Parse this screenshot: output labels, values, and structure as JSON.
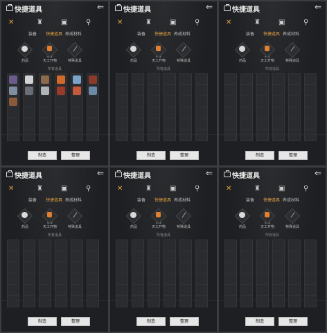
{
  "panels": [
    {
      "title": "快捷道具",
      "tabs": [
        "装备",
        "快捷道具",
        "养成材料"
      ],
      "cats": [
        {
          "name": "药品",
          "count": "4"
        },
        {
          "name": "天工开物",
          "count": "412"
        },
        {
          "name": "特殊道具",
          "count": "1"
        }
      ],
      "section": "所有道具",
      "buttons": [
        "制造",
        "整理"
      ]
    },
    {
      "title": "快捷道具",
      "tabs": [
        "装备",
        "快捷道具",
        "养成材料"
      ],
      "cats": [
        {
          "name": "药品",
          "count": "4"
        },
        {
          "name": "天工开物",
          "count": "412"
        },
        {
          "name": "特殊道具",
          "count": "1"
        }
      ],
      "section": "所有道具",
      "buttons": [
        "制造",
        "整理"
      ]
    },
    {
      "title": "快捷道具",
      "tabs": [
        "装备",
        "快捷道具",
        "养成材料"
      ],
      "cats": [
        {
          "name": "药品",
          "count": "4"
        },
        {
          "name": "天工开物",
          "count": "412"
        },
        {
          "name": "特殊道具",
          "count": "1"
        }
      ],
      "section": "所有道具",
      "buttons": [
        "制造",
        "整理"
      ]
    },
    {
      "title": "快捷道具",
      "tabs": [
        "装备",
        "快捷道具",
        "养成材料"
      ],
      "cats": [
        {
          "name": "药品",
          "count": "4"
        },
        {
          "name": "天工开物",
          "count": "412"
        },
        {
          "name": "特殊道具",
          "count": "1"
        }
      ],
      "section": "所有道具",
      "buttons": [
        "制造",
        "整理"
      ]
    },
    {
      "title": "快捷道具",
      "tabs": [
        "装备",
        "快捷道具",
        "养成材料"
      ],
      "cats": [
        {
          "name": "药品",
          "count": "4"
        },
        {
          "name": "天工开物",
          "count": "412"
        },
        {
          "name": "特殊道具",
          "count": "1"
        }
      ],
      "section": "所有道具",
      "buttons": [
        "制造",
        "整理"
      ]
    },
    {
      "title": "快捷道具",
      "tabs": [
        "装备",
        "快捷道具",
        "养成材料"
      ],
      "cats": [
        {
          "name": "药品",
          "count": "4"
        },
        {
          "name": "天工开物",
          "count": "412"
        },
        {
          "name": "特殊道具",
          "count": "1"
        }
      ],
      "section": "所有道具",
      "buttons": [
        "制造",
        "整理"
      ]
    }
  ],
  "icons": {
    "bag": "bag-icon",
    "back": "back-arrow-icon",
    "close": "close-icon",
    "tab2": "gear-icon",
    "tab3": "chest-icon",
    "tab4": "token-icon"
  },
  "colors": {
    "accent": "#e0a040",
    "panel": "#1e1f22"
  }
}
